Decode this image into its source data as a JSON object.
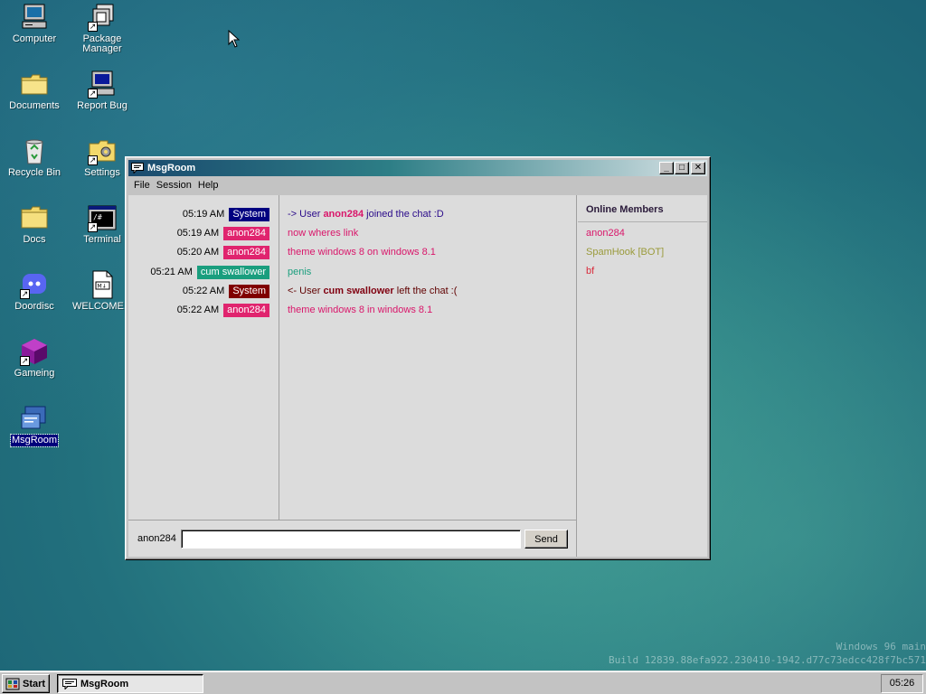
{
  "desktop": {
    "icons": [
      {
        "label": "Computer",
        "icon": "computer-icon"
      },
      {
        "label": "Package Manager",
        "icon": "package-manager-icon"
      },
      {
        "label": "Documents",
        "icon": "folder-icon"
      },
      {
        "label": "Report Bug",
        "icon": "report-bug-icon"
      },
      {
        "label": "Recycle Bin",
        "icon": "recycle-bin-icon"
      },
      {
        "label": "Settings",
        "icon": "settings-icon"
      },
      {
        "label": "Docs",
        "icon": "folder-icon"
      },
      {
        "label": "Terminal",
        "icon": "terminal-icon"
      },
      {
        "label": "Doordisc",
        "icon": "doordisc-icon"
      },
      {
        "label": "WELCOME...",
        "icon": "markdown-file-icon"
      },
      {
        "label": "Gameing",
        "icon": "gameing-icon"
      },
      {
        "label": "MsgRoom",
        "icon": "msgroom-icon"
      }
    ],
    "watermark": {
      "line1": "Windows 96 main",
      "line2": "Build 12839.88efa922.230410-1942.d77c73edcc428f7bc571"
    }
  },
  "window": {
    "title": "MsgRoom",
    "menu": [
      "File",
      "Session",
      "Help"
    ],
    "messages": [
      {
        "time": "05:19 AM",
        "author": "System",
        "badge_color": "#000080",
        "text_parts": [
          "-> User ",
          "anon284",
          " joined the chat :D"
        ],
        "text_color": "#2a0a8a",
        "highlight_color": "#d9166a"
      },
      {
        "time": "05:19 AM",
        "author": "anon284",
        "badge_color": "#e0246e",
        "text": "now wheres link",
        "text_color": "#d9166a"
      },
      {
        "time": "05:20 AM",
        "author": "anon284",
        "badge_color": "#e0246e",
        "text": "theme windows 8 on windows 8.1",
        "text_color": "#d9166a"
      },
      {
        "time": "05:21 AM",
        "author": "cum swallower",
        "badge_color": "#1a9e7e",
        "text": "penis",
        "text_color": "#1a9e7e"
      },
      {
        "time": "05:22 AM",
        "author": "System",
        "badge_color": "#800000",
        "text_parts": [
          "<- User ",
          "cum swallower",
          " left the chat :("
        ],
        "text_color": "#600000",
        "highlight_color": "#800010"
      },
      {
        "time": "05:22 AM",
        "author": "anon284",
        "badge_color": "#e0246e",
        "text": "theme windows 8 in windows 8.1",
        "text_color": "#d9166a"
      }
    ],
    "input": {
      "username": "anon284",
      "value": "",
      "placeholder": ""
    },
    "send_label": "Send",
    "members": {
      "title": "Online Members",
      "list": [
        {
          "name": "anon284",
          "color": "#d9166a"
        },
        {
          "name": "SpamHook [BOT]",
          "color": "#9a9a3a"
        },
        {
          "name": "bf",
          "color": "#d92a3a"
        }
      ]
    }
  },
  "taskbar": {
    "start_label": "Start",
    "items": [
      {
        "label": "MsgRoom"
      }
    ],
    "clock": "05:26"
  }
}
